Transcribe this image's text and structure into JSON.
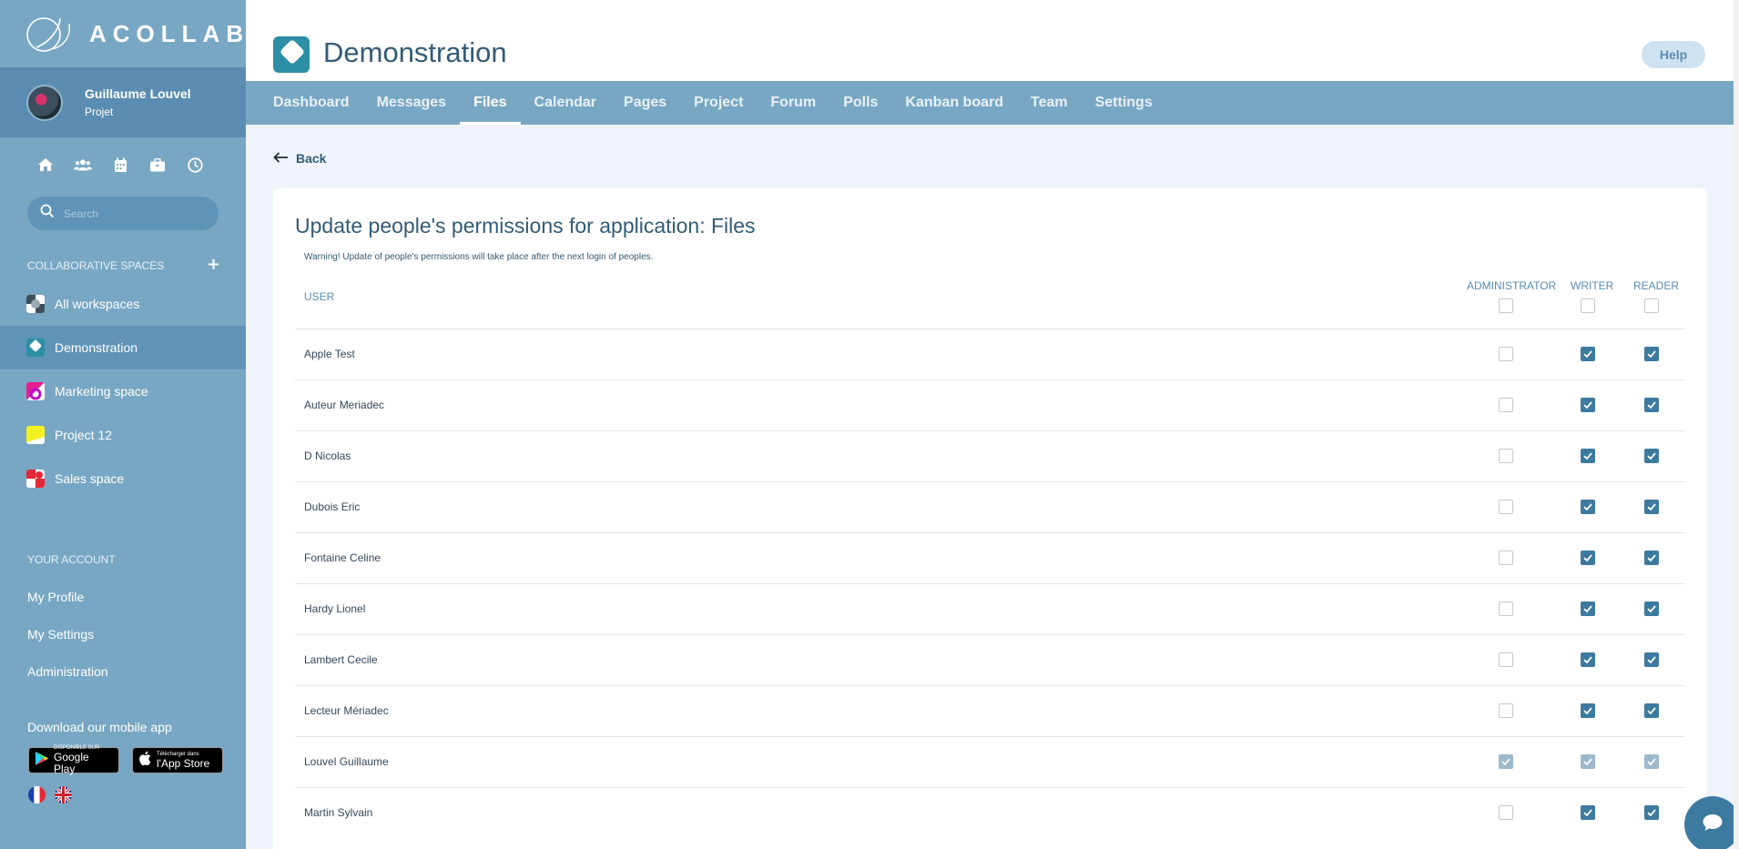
{
  "app": {
    "logo_text": "ACOLLAB"
  },
  "user": {
    "name": "Guillaume Louvel",
    "role": "Projet"
  },
  "quick_icons": [
    "home-icon",
    "users-icon",
    "calendar-icon",
    "briefcase-icon",
    "clock-icon"
  ],
  "search": {
    "placeholder": "Search"
  },
  "sidebar": {
    "collab_title": "COLLABORATIVE SPACES",
    "workspaces": [
      {
        "label": "All workspaces",
        "active": false
      },
      {
        "label": "Demonstration",
        "active": true
      },
      {
        "label": "Marketing space",
        "active": false
      },
      {
        "label": "Project 12",
        "active": false
      },
      {
        "label": "Sales space",
        "active": false
      }
    ],
    "account_title": "YOUR ACCOUNT",
    "account_items": [
      "My Profile",
      "My Settings",
      "Administration"
    ],
    "mobile_title": "Download our mobile app",
    "google_play": {
      "small": "DISPONIBLE SUR",
      "big": "Google Play"
    },
    "app_store": {
      "small": "Télécharger dans",
      "big": "l'App Store"
    }
  },
  "header": {
    "title": "Demonstration",
    "help": "Help"
  },
  "tabs": [
    {
      "label": "Dashboard",
      "active": false
    },
    {
      "label": "Messages",
      "active": false
    },
    {
      "label": "Files",
      "active": true
    },
    {
      "label": "Calendar",
      "active": false
    },
    {
      "label": "Pages",
      "active": false
    },
    {
      "label": "Project",
      "active": false
    },
    {
      "label": "Forum",
      "active": false
    },
    {
      "label": "Polls",
      "active": false
    },
    {
      "label": "Kanban board",
      "active": false
    },
    {
      "label": "Team",
      "active": false
    },
    {
      "label": "Settings",
      "active": false
    }
  ],
  "back_label": "Back",
  "permissions": {
    "title": "Update people's permissions for application: Files",
    "warning": "Warning! Update of people's permissions will take place after the next login of peoples.",
    "columns": {
      "user": "USER",
      "admin": "ADMINISTRATOR",
      "writer": "WRITER",
      "reader": "READER"
    },
    "rows": [
      {
        "name": "Apple Test",
        "admin": false,
        "writer": true,
        "reader": true,
        "disabled": false
      },
      {
        "name": "Auteur Meriadec",
        "admin": false,
        "writer": true,
        "reader": true,
        "disabled": false
      },
      {
        "name": "D Nicolas",
        "admin": false,
        "writer": true,
        "reader": true,
        "disabled": false
      },
      {
        "name": "Dubois Eric",
        "admin": false,
        "writer": true,
        "reader": true,
        "disabled": false
      },
      {
        "name": "Fontaine Celine",
        "admin": false,
        "writer": true,
        "reader": true,
        "disabled": false
      },
      {
        "name": "Hardy Lionel",
        "admin": false,
        "writer": true,
        "reader": true,
        "disabled": false
      },
      {
        "name": "Lambert Cecile",
        "admin": false,
        "writer": true,
        "reader": true,
        "disabled": false
      },
      {
        "name": "Lecteur Mériadec",
        "admin": false,
        "writer": true,
        "reader": true,
        "disabled": false
      },
      {
        "name": "Louvel Guillaume",
        "admin": true,
        "writer": true,
        "reader": true,
        "disabled": true
      },
      {
        "name": "Martin Sylvain",
        "admin": false,
        "writer": true,
        "reader": true,
        "disabled": false
      }
    ]
  },
  "colors": {
    "sidebar": "#78a7c3",
    "accent": "#3d7aa0",
    "title": "#335b75"
  }
}
